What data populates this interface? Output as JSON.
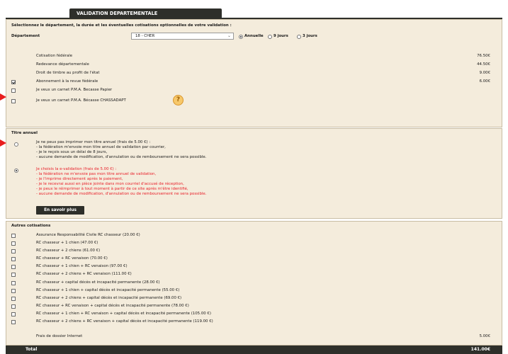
{
  "tab": {
    "title": "VALIDATION DEPARTEMENTALE"
  },
  "instructions": "Sélectionnez le département, la durée et les éventuelles cotisations optionnelles de votre validation :",
  "departement": {
    "label": "Département",
    "selected": "18 - CHER"
  },
  "duration_options": [
    {
      "label": "Annuelle",
      "selected": true
    },
    {
      "label": "9 jours",
      "selected": false
    },
    {
      "label": "3 jours",
      "selected": false
    }
  ],
  "fees": [
    {
      "label": "Cotisation fédérale",
      "amount": "76.50€"
    },
    {
      "label": "Redevance départementale",
      "amount": "44.50€"
    },
    {
      "label": "Droit de timbre au profit de l'état",
      "amount": "9.00€"
    }
  ],
  "options": [
    {
      "label": "Abonnement à la revue fédérale",
      "amount": "6.00€",
      "checked": true
    },
    {
      "label": "Je veux un carnet P.M.A. Becasse Papier",
      "amount": "",
      "checked": false
    },
    {
      "label": "Je veux un carnet P.M.A. Bécasse CHASSADAPT",
      "amount": "",
      "checked": false
    }
  ],
  "help_icon": "question-icon",
  "titre": {
    "heading": "Titre annuel",
    "option1": {
      "selected": false,
      "lines": [
        "Je ne peux pas imprimer mon titre annuel (frais de 5.00 €) :",
        "- la fédération m'envoie mon titre annuel de validation par courrier,",
        "- je le reçois sous un délai de 8 jours,",
        "- aucune demande de modification, d'annulation ou de remboursement ne sera possible."
      ]
    },
    "option2": {
      "selected": true,
      "lines": [
        "Je choisis la e-validation (frais de 5.00 €) :",
        "- la fédération ne m'envoie pas mon titre annuel de validation,",
        "- je l'imprime directement après le paiement,",
        "- je le recevrai aussi en pièce jointe dans mon courriel d'accusé de réception,",
        "- je peux le réimprimer à tout moment à partir de ce site après m'être identifié,",
        "- aucune demande de modification, d'annulation ou de remboursement ne sera possible."
      ]
    },
    "button": "En savoir plus"
  },
  "autres": {
    "heading": "Autres cotisations",
    "items": [
      {
        "label": "Assurance Responsabilité Civile RC chasseur (20.00 €)",
        "checked": false
      },
      {
        "label": "RC chasseur + 1 chien (47.00 €)",
        "checked": false
      },
      {
        "label": "RC chasseur + 2 chiens (61.00 €)",
        "checked": false
      },
      {
        "label": "RC chasseur + RC venaison (70.00 €)",
        "checked": false
      },
      {
        "label": "RC chasseur + 1 chien + RC venaison (97.00 €)",
        "checked": false
      },
      {
        "label": "RC chasseur + 2 chiens + RC venaison (111.00 €)",
        "checked": false
      },
      {
        "label": "RC chasseur + capital décès et incapacité permanente (28.00 €)",
        "checked": false
      },
      {
        "label": "RC chasseur + 1 chien + capital décès et incapacité permanente (55.00 €)",
        "checked": false
      },
      {
        "label": "RC chasseur + 2 chiens + capital décès et incapacité permanente (69.00 €)",
        "checked": false
      },
      {
        "label": "RC chasseur + RC venaison + capital décès et incapacité permanente (78.00 €)",
        "checked": false
      },
      {
        "label": "RC chasseur + 1 chien + RC venaison + capital décès et incapacité permanente (105.00 €)",
        "checked": false
      },
      {
        "label": "RC chasseur + 2 chiens + RC venaison + capital décès et incapacité permanente (119.00 €)",
        "checked": false
      }
    ],
    "frais_label": "Frais de dossier Internet",
    "frais_amount": "5.00€"
  },
  "total": {
    "label": "Total",
    "amount": "141.00€"
  },
  "colors": {
    "accent": "#2e2f2a",
    "panel": "#f4ecdc",
    "warning": "#e8202a",
    "arrow": "#e81d1d"
  }
}
